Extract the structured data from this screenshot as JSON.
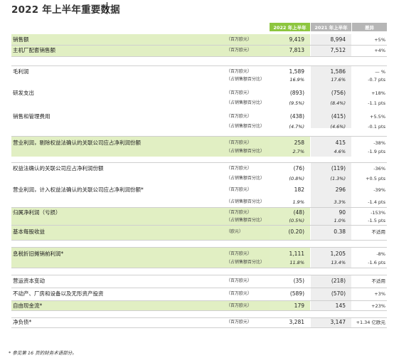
{
  "title": "2022 年上半年重要数据",
  "headers": {
    "c2022": "2022 年上半年",
    "c2021": "2021 年上半年",
    "change": "差异"
  },
  "rows": [
    {
      "label": "销售额",
      "unit": "（百万欧元）",
      "v2022": "9,419",
      "v2021": "8,994",
      "change": "+5%"
    },
    {
      "label": "主机厂配套销售额",
      "unit": "（百万欧元）",
      "v2022": "7,813",
      "v2021": "7,512",
      "change": "+4%"
    },
    {
      "label": "毛利润",
      "unit": "（百万欧元）",
      "v2022": "1,589",
      "v2021": "1,586",
      "change": "— %"
    },
    {
      "label": "",
      "unit": "（占销售额百分比）",
      "v2022": "16.9%",
      "v2021": "17.6%",
      "change": "-0.7 pts"
    },
    {
      "label": "研发支出",
      "unit": "（百万欧元）",
      "v2022": "(893)",
      "v2021": "(756)",
      "change": "+18%"
    },
    {
      "label": "",
      "unit": "（占销售额百分比）",
      "v2022": "(9.5%)",
      "v2021": "(8.4%)",
      "change": "-1.1 pts"
    },
    {
      "label": "销售和管理费用",
      "unit": "（百万欧元）",
      "v2022": "(438)",
      "v2021": "(415)",
      "change": "+5.5%"
    },
    {
      "label": "",
      "unit": "（占销售额百分比）",
      "v2022": "(4.7%)",
      "v2021": "(4.6%)",
      "change": "-0.1 pts"
    },
    {
      "label": "营业利润，剔除权益法确认的关联公司应占净利润份额",
      "unit": "（百万欧元）",
      "v2022": "258",
      "v2021": "415",
      "change": "-38%"
    },
    {
      "label": "",
      "unit": "（占销售额百分比）",
      "v2022": "2.7%",
      "v2021": "4.6%",
      "change": "-1.9 pts"
    },
    {
      "label": "权益法确认的关联公司应占净利润份额",
      "unit": "（百万欧元）",
      "v2022": "(76)",
      "v2021": "(119)",
      "change": "-36%"
    },
    {
      "label": "",
      "unit": "（占销售额百分比）",
      "v2022": "(0.8%)",
      "v2021": "(1.3%)",
      "change": "+0.5 pts"
    },
    {
      "label": "营业利润，计入权益法确认的关联公司应占净利润份额*",
      "unit": "（百万欧元）",
      "v2022": "182",
      "v2021": "296",
      "change": "-39%"
    },
    {
      "label": "",
      "unit": "（占销售额百分比）",
      "v2022": "1.9%",
      "v2021": "3.3%",
      "change": "-1.4 pts"
    },
    {
      "label": "归属净利润（亏损）",
      "unit": "（百万欧元）",
      "v2022": "(48)",
      "v2021": "90",
      "change": "-153%"
    },
    {
      "label": "",
      "unit": "（占销售额百分比）",
      "v2022": "(0.5%)",
      "v2021": "1.0%",
      "change": "-1.5 pts"
    },
    {
      "label": "基本每股收益",
      "unit": "（欧元）",
      "v2022": "(0.20)",
      "v2021": "0.38",
      "change": "不适用"
    },
    {
      "label": "息税折旧摊销前利润*",
      "unit": "（百万欧元）",
      "v2022": "1,111",
      "v2021": "1,205",
      "change": "-8%"
    },
    {
      "label": "",
      "unit": "（占销售额百分比）",
      "v2022": "11.8%",
      "v2021": "13.4%",
      "change": "-1.6 pts"
    },
    {
      "label": "营运资本变动",
      "unit": "（百万欧元）",
      "v2022": "(35)",
      "v2021": "(218)",
      "change": "不适用"
    },
    {
      "label": "不动产、厂房和设备以及无形资产投资",
      "unit": "（百万欧元）",
      "v2022": "(589)",
      "v2021": "(570)",
      "change": "+3%"
    },
    {
      "label": "自由现金流*",
      "unit": "（百万欧元）",
      "v2022": "179",
      "v2021": "145",
      "change": "+23%"
    },
    {
      "label": "净负债*",
      "unit": "（百万欧元）",
      "v2022": "3,281",
      "v2021": "3,147",
      "change": "+1.34 亿欧元"
    }
  ],
  "footnote": "* 参见第 16 页的财务术语部分。",
  "colors": {
    "accent_green": "#8dc63f",
    "row_green": "#e1efc3",
    "header_grey": "#b6b6b6"
  }
}
